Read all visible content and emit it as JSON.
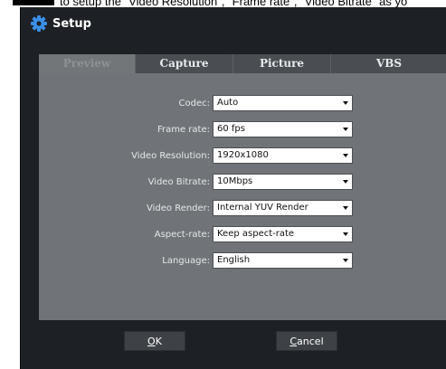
{
  "caption": {
    "text": "to setup the \"Video Resolution\", \"Frame rate\", \"Video Bitrate\" as yo"
  },
  "window": {
    "title": "Setup",
    "icon": "gear-icon"
  },
  "tabs": [
    {
      "label": "Preview",
      "active": true
    },
    {
      "label": "Capture",
      "active": false
    },
    {
      "label": "Picture",
      "active": false
    },
    {
      "label": "VBS",
      "active": false
    }
  ],
  "fields": [
    {
      "label": "Codec:",
      "value": "Auto"
    },
    {
      "label": "Frame rate:",
      "value": "60 fps"
    },
    {
      "label": "Video Resolution:",
      "value": "1920x1080"
    },
    {
      "label": "Video Bitrate:",
      "value": "10Mbps"
    },
    {
      "label": "Video Render:",
      "value": "Internal YUV Render"
    },
    {
      "label": "Aspect-rate:",
      "value": "Keep aspect-rate"
    },
    {
      "label": "Language:",
      "value": "English"
    }
  ],
  "buttons": {
    "ok": {
      "first": "O",
      "rest": "K"
    },
    "cancel": {
      "first": "C",
      "rest": "ancel"
    }
  },
  "colors": {
    "window_bg": "#1d2024",
    "panel_bg": "#707478",
    "tab_bg": "#4a4e53",
    "icon": "#3b8fe8"
  }
}
